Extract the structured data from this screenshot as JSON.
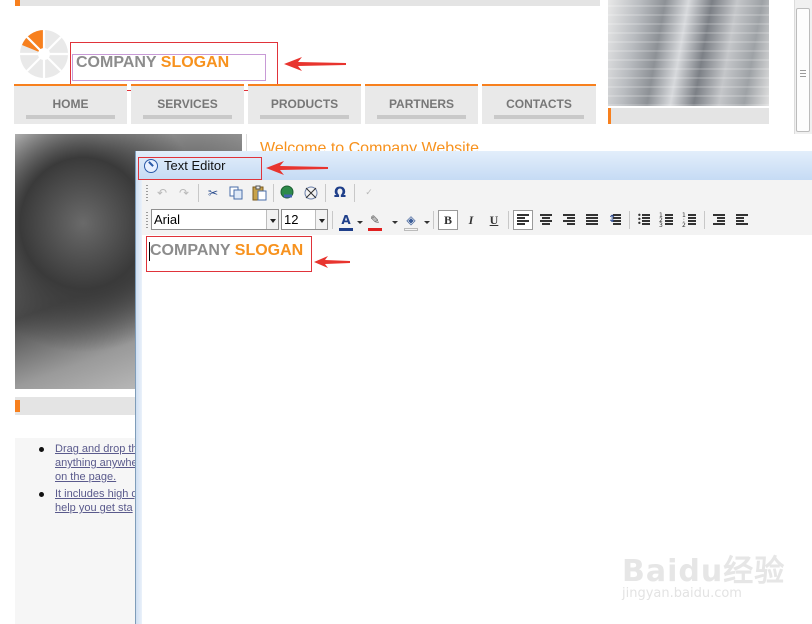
{
  "site": {
    "slogan_main": "COMPANY",
    "slogan_accent": "SLOGAN",
    "nav": [
      "HOME",
      "SERVICES",
      "PRODUCTS",
      "PARTNERS",
      "CONTACTS"
    ],
    "welcome": "Welcome to Company Website",
    "list_items": [
      [
        "Drag and drop the",
        "anything anywhe",
        "on the page."
      ],
      [
        "It includes high q",
        "help you get sta"
      ]
    ],
    "accent_color": "#f7801e"
  },
  "editor": {
    "title": "Text Editor",
    "font": "Arial",
    "font_size": "12",
    "toolbar1": [
      "undo-icon",
      "redo-icon",
      "cut-icon",
      "copy-icon",
      "paste-icon",
      "insert-link-icon",
      "unlink-icon",
      "special-char-icon",
      "spellcheck-icon"
    ],
    "toolbar2": [
      "font-color-icon",
      "highlight-icon",
      "background-color-icon",
      "bold-icon",
      "italic-icon",
      "underline-icon",
      "align-left-icon",
      "align-center-icon",
      "align-right-icon",
      "justify-icon",
      "line-height-icon",
      "bullet-list-icon",
      "numbered-list-icon",
      "checklist-icon",
      "outdent-icon",
      "indent-icon"
    ],
    "bold_label": "B",
    "italic_label": "I",
    "underline_label": "U",
    "special_char_label": "Ω",
    "content_main": "COMPANY",
    "content_accent": "SLOGAN"
  },
  "watermark": {
    "text": "Baidu经验",
    "url": "jingyan.baidu.com"
  }
}
